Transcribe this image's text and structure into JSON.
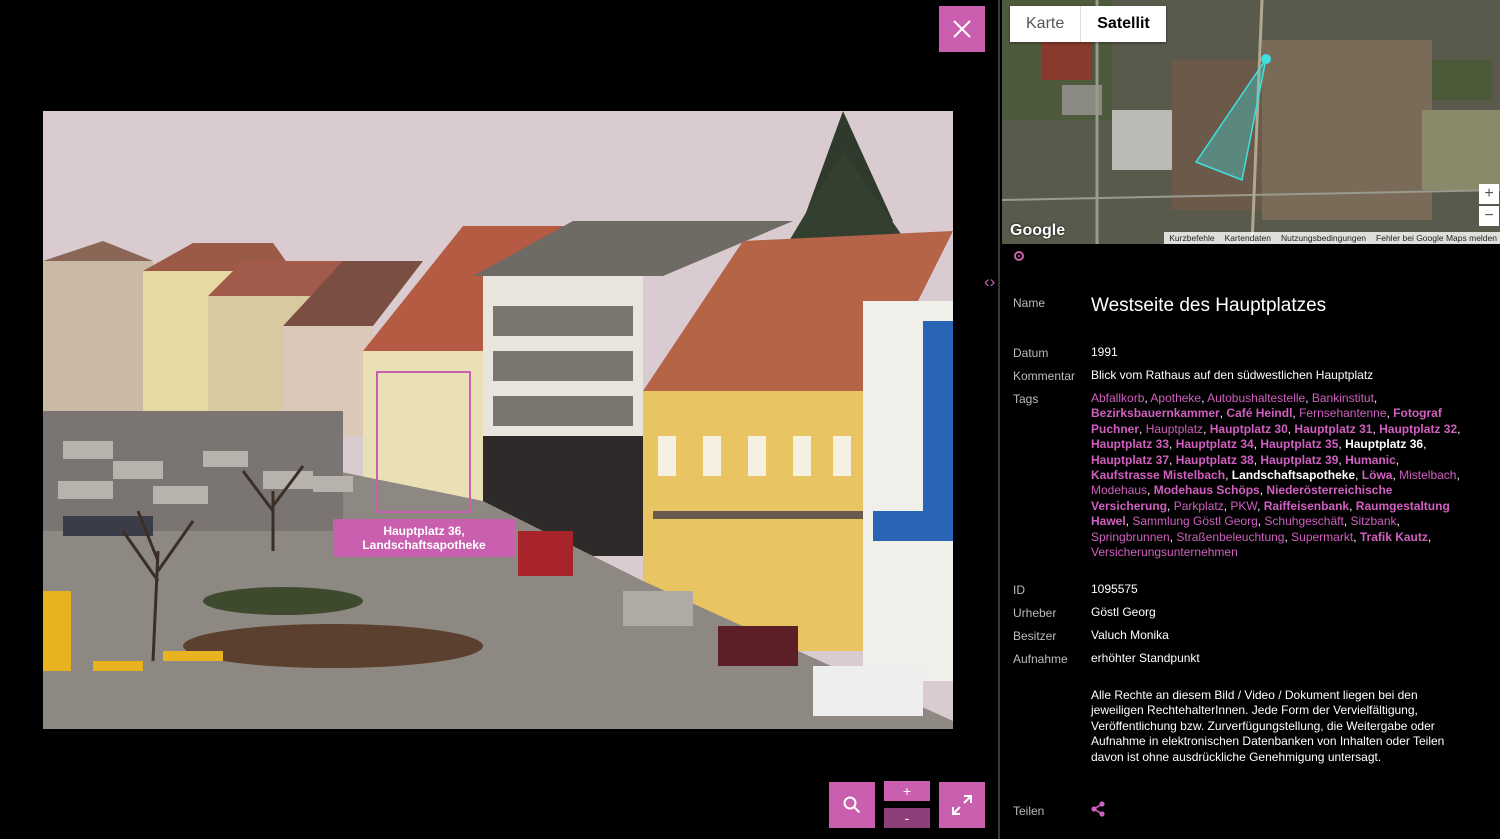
{
  "viewer": {
    "highlight_label_1": "Hauptplatz 36,",
    "highlight_label_2": "Landschaftsapotheke",
    "zoom_in": "+",
    "zoom_out": "-"
  },
  "map": {
    "tabs": [
      "Karte",
      "Satellit"
    ],
    "active_tab": "Satellit",
    "zoom_in": "+",
    "zoom_out": "−",
    "logo": "Google",
    "footer": [
      "Kurzbefehle",
      "Kartendaten",
      "Nutzungsbedingungen",
      "Fehler bei Google Maps melden"
    ]
  },
  "details": {
    "name_label": "Name",
    "name": "Westseite des Hauptplatzes",
    "date_label": "Datum",
    "date": "1991",
    "comment_label": "Kommentar",
    "comment": "Blick vom Rathaus auf den südwestlichen Hauptplatz",
    "tags_label": "Tags",
    "tags": [
      {
        "t": "Abfallkorb",
        "s": "n"
      },
      {
        "t": "Apotheke",
        "s": "n"
      },
      {
        "t": "Autobushaltestelle",
        "s": "n"
      },
      {
        "t": "Bankinstitut",
        "s": "n"
      },
      {
        "t": "Bezirksbauernkammer",
        "s": "b"
      },
      {
        "t": "Café Heindl",
        "s": "b"
      },
      {
        "t": "Fernsehantenne",
        "s": "n"
      },
      {
        "t": "Fotograf Puchner",
        "s": "b"
      },
      {
        "t": "Hauptplatz",
        "s": "n"
      },
      {
        "t": "Hauptplatz 30",
        "s": "b"
      },
      {
        "t": "Hauptplatz 31",
        "s": "b"
      },
      {
        "t": "Hauptplatz 32",
        "s": "b"
      },
      {
        "t": "Hauptplatz 33",
        "s": "b"
      },
      {
        "t": "Hauptplatz 34",
        "s": "b"
      },
      {
        "t": "Hauptplatz 35",
        "s": "b"
      },
      {
        "t": "Hauptplatz 36",
        "s": "w"
      },
      {
        "t": "Hauptplatz 37",
        "s": "b"
      },
      {
        "t": "Hauptplatz 38",
        "s": "b"
      },
      {
        "t": "Hauptplatz 39",
        "s": "b"
      },
      {
        "t": "Humanic",
        "s": "b"
      },
      {
        "t": "Kaufstrasse Mistelbach",
        "s": "b"
      },
      {
        "t": "Landschaftsapotheke",
        "s": "w"
      },
      {
        "t": "Löwa",
        "s": "b"
      },
      {
        "t": "Mistelbach",
        "s": "n"
      },
      {
        "t": "Modehaus",
        "s": "n"
      },
      {
        "t": "Modehaus Schöps",
        "s": "b"
      },
      {
        "t": "Niederösterreichische Versicherung",
        "s": "b"
      },
      {
        "t": "Parkplatz",
        "s": "n"
      },
      {
        "t": "PKW",
        "s": "n"
      },
      {
        "t": "Raiffeisenbank",
        "s": "b"
      },
      {
        "t": "Raumgestaltung Hawel",
        "s": "b"
      },
      {
        "t": "Sammlung Göstl Georg",
        "s": "n"
      },
      {
        "t": "Schuhgeschäft",
        "s": "n"
      },
      {
        "t": "Sitzbank",
        "s": "n"
      },
      {
        "t": "Springbrunnen",
        "s": "n"
      },
      {
        "t": "Straßenbeleuchtung",
        "s": "n"
      },
      {
        "t": "Supermarkt",
        "s": "n"
      },
      {
        "t": "Trafik Kautz",
        "s": "b"
      },
      {
        "t": "Versicherungsunternehmen",
        "s": "n"
      }
    ],
    "id_label": "ID",
    "id": "1095575",
    "author_label": "Urheber",
    "author": "Göstl Georg",
    "owner_label": "Besitzer",
    "owner": "Valuch Monika",
    "shot_label": "Aufnahme",
    "shot": "erhöhter Standpunkt",
    "legal": "Alle Rechte an diesem Bild / Video / Dokument liegen bei den jeweiligen RechtehalterInnen. Jede Form der Vervielfältigung, Veröffentlichung bzw. Zurverfügungstellung, die Weitergabe oder Aufnahme in elektronischen Datenbanken von Inhalten oder Teilen davon ist ohne ausdrückliche Genehmigung untersagt.",
    "share_label": "Teilen"
  },
  "colors": {
    "accent": "#c95fae",
    "tag": "#d15fc0",
    "background": "#000000"
  }
}
